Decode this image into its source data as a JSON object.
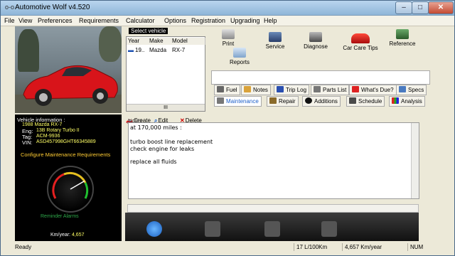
{
  "window": {
    "title": "Automotive Wolf v4.520",
    "icon": "app-icon-oo",
    "min_glyph": "–",
    "max_glyph": "□",
    "close_glyph": "✕"
  },
  "menu": [
    "File",
    "View",
    "Preferences",
    "Requirements",
    "Calculator",
    "Options",
    "Registration",
    "Upgrading",
    "Help"
  ],
  "vehicle": {
    "group_title": "Select vehicle",
    "columns": [
      "Year",
      "Make",
      "Model"
    ],
    "row": {
      "year": "19..",
      "make": "Mazda",
      "model": "RX-7"
    },
    "scroll_glyph": "III",
    "actions": {
      "create": "Create",
      "edit": "Edit",
      "delete": "Delete"
    }
  },
  "toolbar": {
    "print": "Print",
    "reports": "Reports",
    "service": "Service",
    "diagnose": "Diagnose",
    "car_care_tips": "Car Care Tips",
    "reference": "Reference"
  },
  "tabs_row1": [
    "Fuel",
    "Notes",
    "Trip Log",
    "Parts List",
    "What's Due?",
    "Specs"
  ],
  "tabs_row2": [
    "Maintenance",
    "Repair",
    "Additions",
    "Schedule",
    "Analysis"
  ],
  "info": {
    "header": "Vehicle information :",
    "name": "1988 Mazda RX-7",
    "eng_label": "Eng:",
    "eng": "13B Rotary Turbo II",
    "tag_label": "Tag:",
    "tag": "ACM-9936",
    "vin_label": "VIN:",
    "vin": "ASD457998GHT66345889",
    "configure": "Configure Maintenance Requirements",
    "reminder_title": "Reminder Alarms",
    "km_label": "Km/year:",
    "km_value": "4,657",
    "gauge_fraction": 0.75
  },
  "notes": {
    "title": "Notes",
    "lines": [
      "at 170,000 miles :",
      "",
      "turbo boost line replacement",
      "check engine for leaks",
      "",
      "replace all fluids"
    ]
  },
  "status": {
    "ready": "Ready",
    "consumption": "17 L/100Km",
    "km_year": "4,657 Km/year",
    "num": "NUM"
  },
  "colors": {
    "accent_tab": "#1d5fc9",
    "info_value": "#ffff66",
    "configure_link": "#ffcc33",
    "reminder": "#2ea84a",
    "car_red": "#d8141a"
  }
}
